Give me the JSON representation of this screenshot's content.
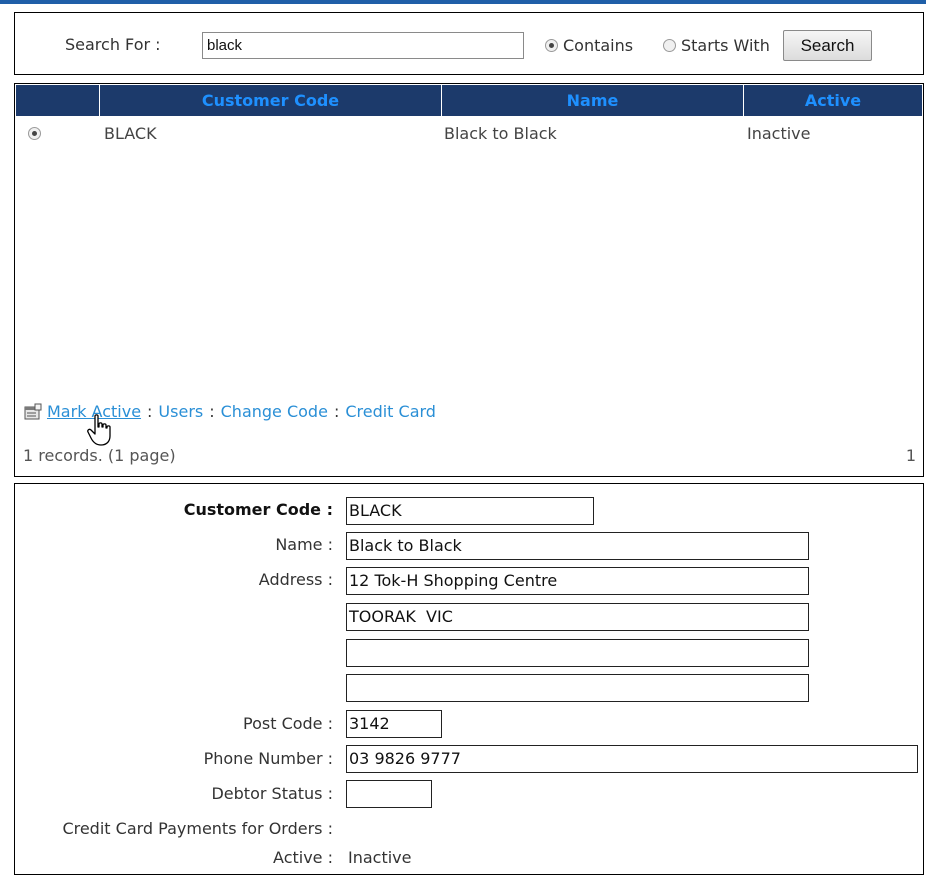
{
  "search": {
    "label": "Search For :",
    "value": "black",
    "contains_label": "Contains",
    "starts_with_label": "Starts With",
    "button_label": "Search",
    "mode_selected": "Contains"
  },
  "grid": {
    "columns": [
      "",
      "Customer Code",
      "Name",
      "Active"
    ],
    "rows": [
      {
        "code": "BLACK",
        "name": "Black to Black",
        "active": "Inactive",
        "selected": true
      }
    ],
    "header_text_color": "#1e90ff",
    "header_bg_color": "#1c3a6b"
  },
  "actions": {
    "mark_active": "Mark Active",
    "users": "Users",
    "change_code": "Change Code",
    "credit_card": "Credit Card",
    "separator": ":"
  },
  "pager": {
    "records": "1 records. (1 page)",
    "page": "1"
  },
  "detail": {
    "customer_code_label": "Customer Code :",
    "customer_code": "BLACK",
    "name_label": "Name :",
    "name": "Black to Black",
    "address_label": "Address :",
    "address_1": "12 Tok-H Shopping Centre",
    "address_2": "TOORAK  VIC",
    "address_3": "",
    "address_4": "",
    "post_code_label": "Post Code :",
    "post_code": "3142",
    "phone_label": "Phone Number :",
    "phone": "03 9826 9777",
    "debtor_label": "Debtor Status :",
    "debtor_status": "",
    "credit_card_label": "Credit Card Payments for Orders :",
    "active_label": "Active :",
    "active": "Inactive"
  },
  "colors": {
    "link": "#2a8fd6",
    "top_accent": "#1f5fa8"
  }
}
